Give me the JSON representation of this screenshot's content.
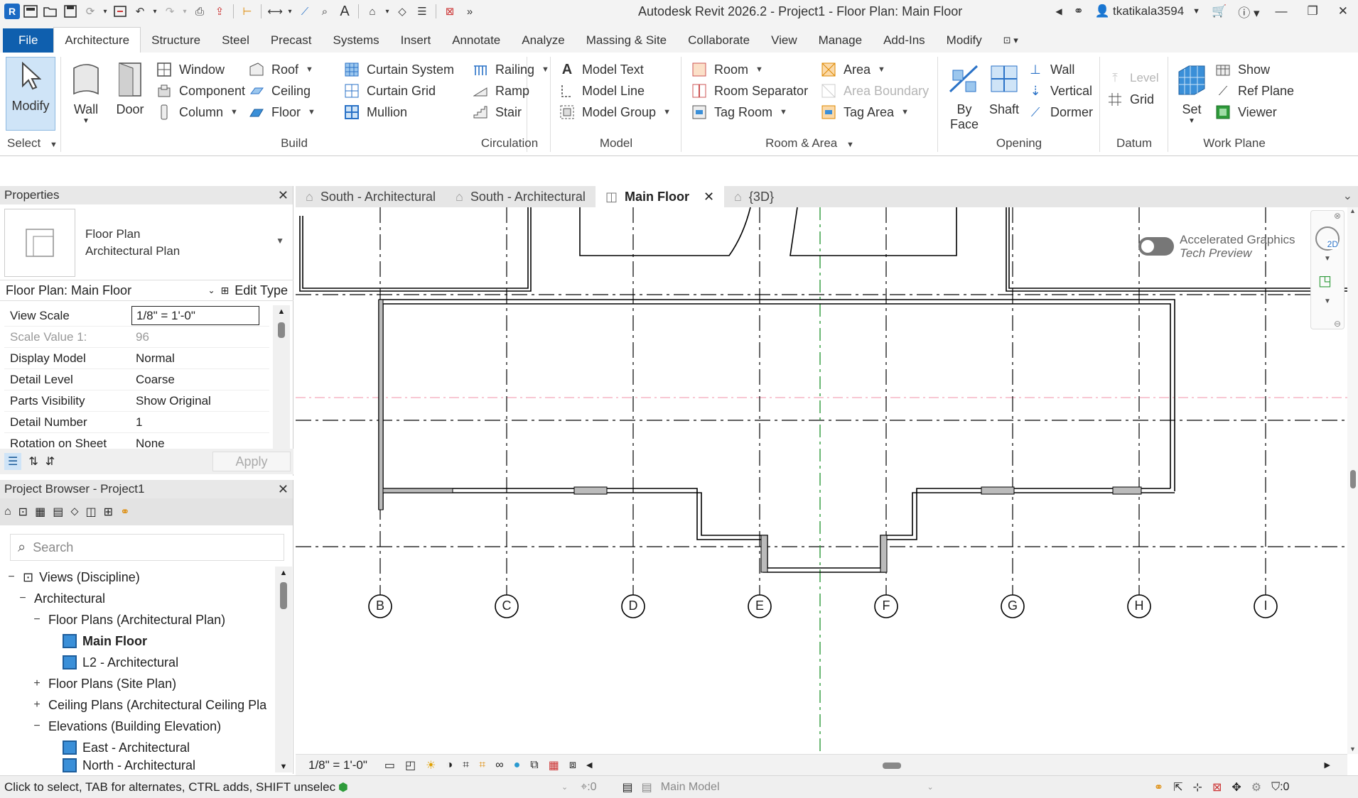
{
  "title_bar": {
    "app_title": "Autodesk Revit 2026.2 - Project1 - Floor Plan: Main Floor",
    "username": "tkatikala3594",
    "logo_letter": "R"
  },
  "ribbon_tabs": [
    "File",
    "Architecture",
    "Structure",
    "Steel",
    "Precast",
    "Systems",
    "Insert",
    "Annotate",
    "Analyze",
    "Massing & Site",
    "Collaborate",
    "View",
    "Manage",
    "Add-Ins",
    "Modify"
  ],
  "ribbon": {
    "select": {
      "modify": "Modify",
      "title": "Select"
    },
    "build": {
      "wall": "Wall",
      "door": "Door",
      "window": "Window",
      "component": "Component",
      "column": "Column",
      "roof": "Roof",
      "ceiling": "Ceiling",
      "floor": "Floor",
      "curtain_system": "Curtain  System",
      "curtain_grid": "Curtain  Grid",
      "mullion": "Mullion",
      "title": "Build"
    },
    "circulation": {
      "railing": "Railing",
      "ramp": "Ramp",
      "stair": "Stair",
      "title": "Circulation"
    },
    "model": {
      "model_text": "Model  Text",
      "model_line": "Model  Line",
      "model_group": "Model  Group",
      "title": "Model"
    },
    "room_area": {
      "room": "Room",
      "room_separator": "Room  Separator",
      "tag_room": "Tag  Room",
      "area": "Area",
      "area_boundary": "Area  Boundary",
      "tag_area": "Tag  Area",
      "title": "Room & Area"
    },
    "opening": {
      "by_face_1": "By",
      "by_face_2": "Face",
      "shaft": "Shaft",
      "wall": "Wall",
      "vertical": "Vertical",
      "dormer": "Dormer",
      "title": "Opening"
    },
    "datum": {
      "level": "Level",
      "grid": "Grid",
      "title": "Datum"
    },
    "work_plane": {
      "set": "Set",
      "show": "Show",
      "ref_plane": "Ref  Plane",
      "viewer": "Viewer",
      "title": "Work Plane"
    }
  },
  "properties": {
    "header": "Properties",
    "type_line1": "Floor Plan",
    "type_line2": "Architectural Plan",
    "instance": "Floor Plan: Main Floor",
    "edit_type": "Edit Type",
    "rows": [
      {
        "name": "View Scale",
        "value": "1/8\" = 1'-0\""
      },
      {
        "name": "Scale Value    1:",
        "value": "96"
      },
      {
        "name": "Display Model",
        "value": "Normal"
      },
      {
        "name": "Detail Level",
        "value": "Coarse"
      },
      {
        "name": "Parts Visibility",
        "value": "Show Original"
      },
      {
        "name": "Detail Number",
        "value": "1"
      },
      {
        "name": "Rotation on Sheet",
        "value": "None"
      }
    ],
    "apply": "Apply"
  },
  "project_browser": {
    "header": "Project Browser - Project1",
    "search_placeholder": "Search",
    "tree": [
      {
        "label": "Views (Discipline)"
      },
      {
        "label": "Architectural"
      },
      {
        "label": "Floor Plans (Architectural Plan)"
      },
      {
        "label": "Main Floor"
      },
      {
        "label": "L2 - Architectural"
      },
      {
        "label": "Floor Plans (Site Plan)"
      },
      {
        "label": "Ceiling Plans (Architectural Ceiling Pla"
      },
      {
        "label": "Elevations (Building Elevation)"
      },
      {
        "label": "East - Architectural"
      },
      {
        "label": "North - Architectural"
      }
    ]
  },
  "view_tabs": [
    "South - Architectural",
    "South - Architectural",
    "Main Floor",
    "{3D}"
  ],
  "canvas": {
    "grid_labels": [
      "B",
      "C",
      "D",
      "E",
      "F",
      "G",
      "H",
      "I"
    ],
    "accel_graphics_line1": "Accelerated Graphics",
    "accel_graphics_line2": "Tech Preview",
    "navbar_2d": "2D"
  },
  "view_control_bar": {
    "scale": "1/8\" = 1'-0\""
  },
  "status_bar": {
    "hint": "Click to select, TAB for alternates, CTRL adds, SHIFT unselect",
    "worksets_count": ":0",
    "model": "Main Model",
    "filter_count": ":0"
  },
  "colors": {
    "file_tab": "#0f5fae",
    "icon_blue": "#3a8fd8",
    "grid_line": "#000000",
    "level_pink": "#f4a7b9",
    "ref_green": "#2e9b3a"
  }
}
